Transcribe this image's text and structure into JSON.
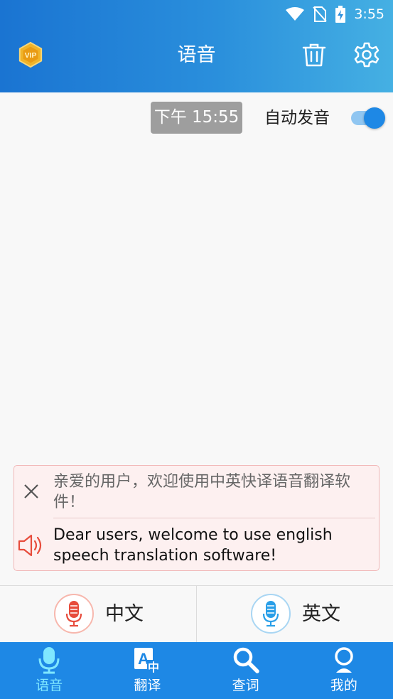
{
  "status_bar": {
    "time": "3:55"
  },
  "header": {
    "title": "语音",
    "vip_icon": "vip-badge-icon"
  },
  "chat": {
    "timestamp": "下午 15:55"
  },
  "auto_speak": {
    "label": "自动发音",
    "enabled": true
  },
  "tip": {
    "cn": "亲爱的用户，欢迎使用中英快译语音翻译软件！",
    "en": "Dear users, welcome to use english speech translation software!"
  },
  "languages": {
    "chinese": {
      "label": "中文",
      "color": "#e74c3c"
    },
    "english": {
      "label": "英文",
      "color": "#2a9fe8"
    }
  },
  "bottom_nav": {
    "items": [
      {
        "label": "语音",
        "icon": "microphone-icon",
        "active": true
      },
      {
        "label": "翻译",
        "icon": "translate-icon",
        "active": false
      },
      {
        "label": "查词",
        "icon": "search-icon",
        "active": false
      },
      {
        "label": "我的",
        "icon": "profile-icon",
        "active": false
      }
    ]
  },
  "colors": {
    "primary": "#1e88e5",
    "active_tab": "#7fe7ff",
    "tip_bg": "#fdf0f0"
  }
}
